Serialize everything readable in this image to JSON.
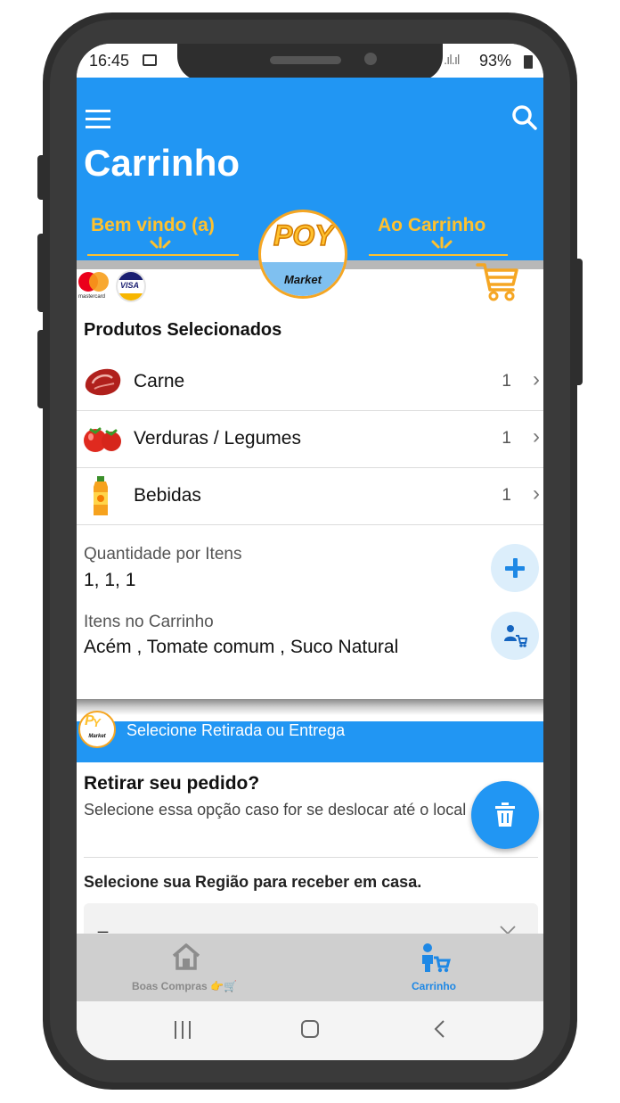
{
  "status": {
    "time": "16:45",
    "battery": "93%"
  },
  "appbar": {
    "title": "Carrinho"
  },
  "banner": {
    "left_text": "Bem vindo (a)",
    "right_text": "Ao Carrinho",
    "logo_top": "POY",
    "logo_bottom": "Market"
  },
  "cards": {
    "mastercard_label": "mastercard",
    "visa_label": "VISA"
  },
  "products": {
    "heading": "Produtos Selecionados",
    "items": [
      {
        "label": "Carne",
        "count": "1"
      },
      {
        "label": "Verduras / Legumes",
        "count": "1"
      },
      {
        "label": "Bebidas",
        "count": "1"
      }
    ]
  },
  "summary": {
    "qty_label": "Quantidade por Itens",
    "qty_value": "1, 1, 1",
    "items_label": "Itens no Carrinho",
    "items_value": "Acém , Tomate comum , Suco Natural"
  },
  "delivery": {
    "header": "Selecione Retirada ou Entrega",
    "logo_bottom": "Market",
    "pickup_title": "Retirar seu pedido?",
    "pickup_desc": "Selecione essa opção caso for se deslocar até o local",
    "region_label": "Selecione sua Região para receber em casa.",
    "region_value": "_"
  },
  "bottom_nav": {
    "home_label": "Boas Compras 👉🛒",
    "cart_label": "Carrinho"
  },
  "colors": {
    "primary": "#2196f3",
    "accent": "#ffc12e",
    "frame": "#2e2e2e"
  }
}
